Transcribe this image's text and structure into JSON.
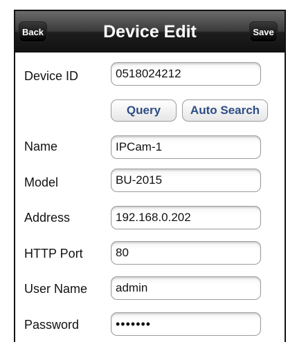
{
  "navbar": {
    "title": "Device Edit",
    "back_label": "Back",
    "save_label": "Save"
  },
  "form": {
    "device_id": {
      "label": "Device ID",
      "value": "0518024212"
    },
    "query_label": "Query",
    "auto_search_label": "Auto Search",
    "name": {
      "label": "Name",
      "value": "IPCam-1"
    },
    "model": {
      "label": "Model",
      "value": "BU-2015"
    },
    "address": {
      "label": "Address",
      "value": "192.168.0.202"
    },
    "http_port": {
      "label": "HTTP Port",
      "value": "80"
    },
    "user_name": {
      "label": "User Name",
      "value": "admin"
    },
    "password": {
      "label": "Password",
      "value": "•••••••"
    }
  },
  "colors": {
    "navbar": "#1d1d1d",
    "button_text": "#2d4d84"
  }
}
